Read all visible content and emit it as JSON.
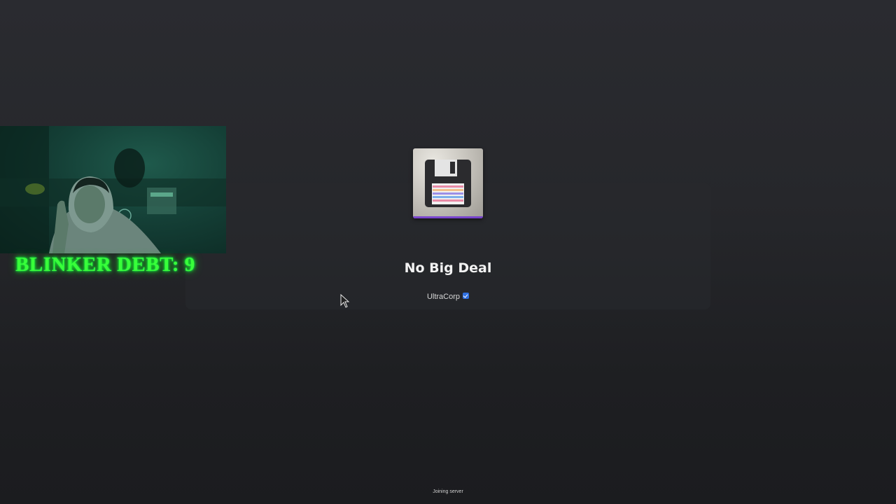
{
  "game": {
    "title": "No Big Deal",
    "creator": "UltraCorp",
    "icon": "floppy-disk-icon"
  },
  "loading": {
    "status": "Joining server"
  },
  "overlay": {
    "counter_text": "BLINKER DEBT: 9",
    "counter_color": "#39ff3a"
  },
  "colors": {
    "verified_badge": "#2f6fe0",
    "background": "#26272b"
  }
}
